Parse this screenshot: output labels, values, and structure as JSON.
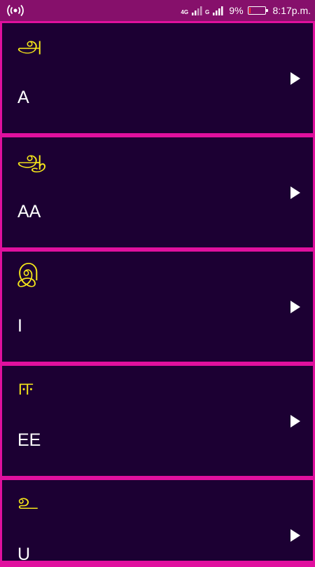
{
  "status_bar": {
    "hotspot_icon": "wifi-hotspot-icon",
    "network_type": "4G",
    "sim2_label": "G",
    "battery_percent_text": "9%",
    "battery_level": 0.09,
    "time": "8:17p.m."
  },
  "letters": [
    {
      "tamil": "அ",
      "latin": "A"
    },
    {
      "tamil": "ஆ",
      "latin": "AA"
    },
    {
      "tamil": "இ",
      "latin": "I"
    },
    {
      "tamil": "ஈ",
      "latin": "EE"
    },
    {
      "tamil": "உ",
      "latin": "U"
    }
  ],
  "colors": {
    "background_border": "#e0109e",
    "card_background": "#1c0033",
    "tamil_text": "#f5e61a",
    "latin_text": "#ffffff",
    "status_bar": "#86106b"
  }
}
